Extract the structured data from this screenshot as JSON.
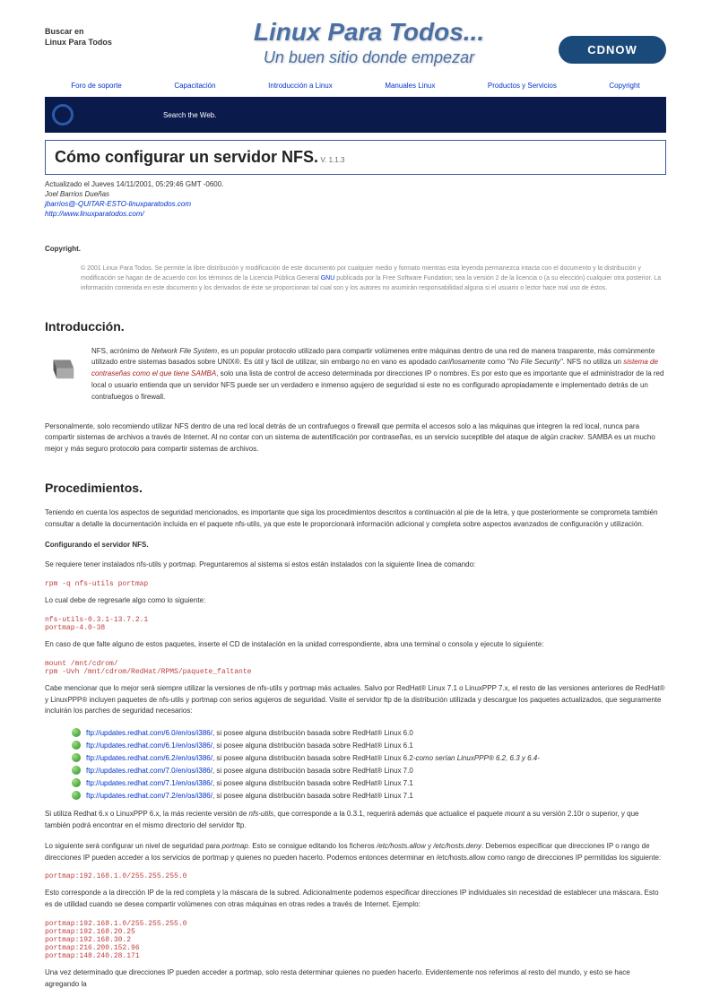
{
  "header": {
    "search_label1": "Buscar en",
    "search_label2": "Linux Para Todos",
    "logo_title": "Linux Para Todos...",
    "logo_sub": "Un buen sitio donde empezar",
    "cdnow": "CDNOW"
  },
  "nav": {
    "n0": "Foro de soporte",
    "n1": "Capacitación",
    "n2": "Introducción a Linux",
    "n3": "Manuales Linux",
    "n4": "Productos y Servicios",
    "n5": "Copyright"
  },
  "searchbar": {
    "text": "Search the Web."
  },
  "title": {
    "main": "Cómo configurar un servidor NFS.",
    "ver": "V. 1.1.3"
  },
  "meta": {
    "updated": "Actualizado el Jueves 14/11/2001, 05:29:46 GMT -0600.",
    "author": "Joel Barrios Dueñas",
    "email": "jbarrios@-QUITAR-ESTO-linuxparatodos.com",
    "url": "http://www.linuxparatodos.com/"
  },
  "copyright": {
    "label": "Copyright.",
    "pre": "© 2001 Linux Para Todos. Se permite la libre distribución y modificación de este documento por cualquier medio y formato mientras esta leyenda permanezca intacta con el documento y la distribución y modificación se hagan de de acuerdo con los términos de la Licencia Pública General ",
    "link": "GNU",
    "post": " publicada por la Free Software Fundation; sea la versión 2 de la licencia o (a su elección) cualquier otra posterior. La información contenida en este documento y los derivados de éste se proporcionan tal cual son y los autores no asumirán responsabilidad alguna si el usuario o lector hace mal uso de éstos."
  },
  "sections": {
    "intro_h": "Introducción.",
    "intro_p1_a": "NFS, acrónimo de ",
    "intro_p1_b": "Network File System",
    "intro_p1_c": ", es un popular protocolo utilizado para compartir volúmenes entre máquinas dentro de una red de manera trasparente, más comúnmente utilizado entre sistemas basados sobre UNIX®. Es útil y fácil de utilizar, sin embargo no en vano es apodado ",
    "intro_p1_d": "cariñosamente",
    "intro_p1_e": " como ",
    "intro_p1_f": "\"No File Security\"",
    "intro_p1_g": ". NFS no utiliza un ",
    "intro_p1_h": "sistema de contraseñas como el que tiene SAMBA",
    "intro_p1_i": ", solo una lista de control de acceso determinada por direcciones IP o nombres. Es por esto que es importante que el administrador de la red local o usuario entienda que un servidor NFS puede ser un verdadero e inmenso agujero de seguridad si este no es configurado apropiadamente e implementado detrás de un contrafuegos o firewall.",
    "intro_p2_a": "Personalmente, solo recomiendo utilizar NFS dentro de una red local detrás de un contrafuegos o firewall que permita el accesos solo a las máquinas que integren la red local, nunca para compartir sistemas de archivos a través de Internet. Al no contar con un sistema de autentificación por contraseñas, es un servicio suceptible del ataque de algún ",
    "intro_p2_b": "cracker",
    "intro_p2_c": ". SAMBA es un mucho mejor y más seguro protocolo para compartir sistemas de archivos.",
    "proc_h": "Procedimientos.",
    "proc_p1": "Teniendo en cuenta los aspectos de seguridad mencionados, es importante que siga los procedimientos descritos a continuación al pie de la letra, y que posteriormente se comprometa también consultar a detalle la documentación incluida en el paquete nfs-utils, ya que este le proporcionará información adicional y completa sobre aspectos avanzados de configuración y utilización.",
    "proc_b1": "Configurando el servidor NFS.",
    "proc_p2": "Se requiere tener instalados nfs-utils y portmap. Preguntaremos al sistema si estos están instalados con la siguiente línea de comando:",
    "cmd1": "rpm -q nfs-utils portmap",
    "proc_p3": "Lo cual debe de regresarle algo como lo siguiente:",
    "cmd2": "nfs-utils-0.3.1-13.7.2.1\nportmap-4.0-38",
    "proc_p4": "En caso de que falte alguno de estos paquetes, inserte el CD de instalación en la unidad correspondiente, abra una terminal o consola y ejecute lo siguiente:",
    "cmd3": "mount /mnt/cdrom/\nrpm -Uvh /mnt/cdrom/RedHat/RPMS/paquete_faltante",
    "proc_p5": "Cabe mencionar que lo mejor será siempre utilizar la versiones de nfs-utils y portmap más actuales. Salvo por RedHat® Linux 7.1 o LinuxPPP 7.x, el resto de las versiones anteriores de RedHat® y LinuxPPP® incluyen paquetes de nfs-utils y portmap con serios agujeros de seguridad. Visite el servidor ftp de la distribución utilizada y descargue los paquetes actualizados, que seguramente incluirán los parches de seguridad necesarios:",
    "links": [
      {
        "url": "ftp://updates.redhat.com/6.0/en/os/i386/",
        "txt": ", si posee alguna distribución basada sobre RedHat® Linux 6.0"
      },
      {
        "url": "ftp://updates.redhat.com/6.1/en/os/i386/",
        "txt": ", si posee alguna distribución basada sobre RedHat® Linux 6.1"
      },
      {
        "url": "ftp://updates.redhat.com/6.2/en/os/i386/",
        "txt": ", si posee alguna distribución basada sobre RedHat® Linux 6.2 ",
        "em": "-como serían LinuxPPP® 6.2, 6.3 y 6.4-"
      },
      {
        "url": "ftp://updates.redhat.com/7.0/en/os/i386/",
        "txt": ", si posee alguna distribución basada sobre RedHat® Linux 7.0"
      },
      {
        "url": "ftp://updates.redhat.com/7.1/en/os/i386/",
        "txt": ", si posee alguna distribución basada sobre RedHat® Linux 7.1"
      },
      {
        "url": "ftp://updates.redhat.com/7.2/en/os/i386/",
        "txt": ", si posee alguna distribución basada sobre RedHat® Linux 7.1"
      }
    ],
    "proc_p6_a": "Si utiliza Redhat 6.x o LinuxPPP 6.x, la más reciente versión de ",
    "proc_p6_b": "nfs-utils",
    "proc_p6_c": ", que corresponde a la 0.3.1, requerirá además que actualice el paquete ",
    "proc_p6_d": "mount",
    "proc_p6_e": " a su versión 2.10r o superior, y que también podrá encontrar en el mismo directorio del servidor ftp.",
    "proc_p7_a": "Lo siguiente será configurar un nivel de seguridad para ",
    "proc_p7_b": "portmap",
    "proc_p7_c": ". Esto se consigue editando los ficheros ",
    "proc_p7_d": "/etc/hosts.allow",
    "proc_p7_e": " y ",
    "proc_p7_f": "/etc/hosts.deny",
    "proc_p7_g": ". Debemos especificar que direcciones IP o rango de direcciones IP pueden acceder a los servicios de portmap y quienes no pueden hacerlo. Podemos entonces determinar en /etc/hosts.allow como rango de direcciones IP permitidas los siguiente:",
    "cmd4": "portmap:192.168.1.0/255.255.255.0",
    "proc_p8": "Esto corresponde a la dirección IP de la red completa y la máscara de la subred. Adicionalmente podemos especificar direcciones IP individuales sin necesidad de establecer una máscara. Esto es de utilidad cuando se desea compartir volúmenes con otras máquinas en otras redes a través de Internet. Ejemplo:",
    "cmd5": "portmap:192.168.1.0/255.255.255.0\nportmap:192.168.20.25\nportmap:192.168.30.2\nportmap:216.200.152.96\nportmap:148.240.28.171",
    "proc_p9": "Una vez determinado que direcciones IP pueden acceder a portmap, solo resta determinar quienes no pueden hacerlo. Evidentemente nos referimos al resto del mundo, y esto se hace agregando la"
  }
}
